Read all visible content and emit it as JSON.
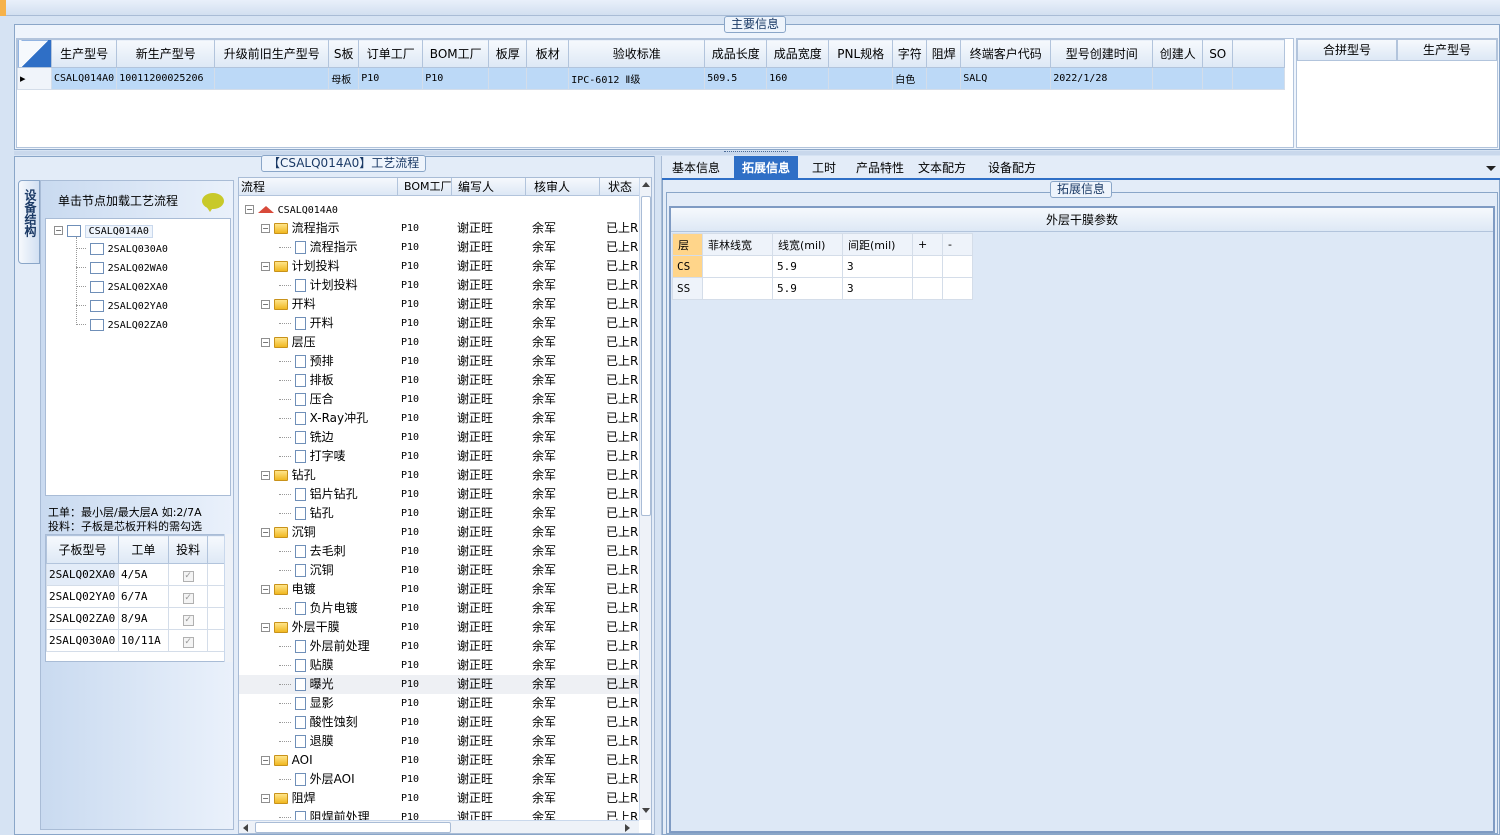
{
  "main_info": {
    "title": "主要信息",
    "headers": [
      "生产型号",
      "新生产型号",
      "升级前旧生产型号",
      "S板",
      "订单工厂",
      "BOM工厂",
      "板厚",
      "板材",
      "验收标准",
      "成品长度",
      "成品宽度",
      "PNL规格",
      "字符",
      "阻焊",
      "终端客户代码",
      "型号创建时间",
      "创建人",
      "SO"
    ],
    "row": [
      "CSALQ014A0",
      "10011200025206",
      "",
      "母板",
      "P10",
      "P10",
      "",
      "",
      "IPC-6012 Ⅱ级",
      "509.5",
      "160",
      "",
      "白色",
      "",
      "SALQ",
      "2022/1/28",
      "",
      ""
    ],
    "right_headers": [
      "合拼型号",
      "生产型号"
    ]
  },
  "flow_panel": {
    "title": "【CSALQ014A0】工艺流程",
    "side_tab": "设备结构",
    "load_hint": "单击节点加载工艺流程",
    "tree": {
      "root": "CSALQ014A0",
      "children": [
        "2SALQ030A0",
        "2SALQ02WA0",
        "2SALQ02XA0",
        "2SALQ02YA0",
        "2SALQ02ZA0"
      ]
    },
    "note_line1": "工单：最小层/最大层A 如:2/7A",
    "note_line2": "投料：子板是芯板开料的需勾选",
    "sub_table": {
      "headers": [
        "子板型号",
        "工单",
        "投料"
      ],
      "rows": [
        {
          "model": "2SALQ02XA0",
          "order": "4/5A"
        },
        {
          "model": "2SALQ02YA0",
          "order": "6/7A"
        },
        {
          "model": "2SALQ02ZA0",
          "order": "8/9A"
        },
        {
          "model": "2SALQ030A0",
          "order": "10/11A"
        }
      ]
    },
    "columns": [
      "流程",
      "BOM工厂",
      "编写人",
      "核审人",
      "状态"
    ],
    "root_name": "CSALQ014A0",
    "factory": "P10",
    "writer": "谢正旺",
    "reviewer": "余军",
    "status": "已上RI",
    "rows": [
      {
        "name": "流程指示",
        "level": 1
      },
      {
        "name": "流程指示",
        "level": 2
      },
      {
        "name": "计划投料",
        "level": 1
      },
      {
        "name": "计划投料",
        "level": 2
      },
      {
        "name": "开料",
        "level": 1
      },
      {
        "name": "开料",
        "level": 2
      },
      {
        "name": "层压",
        "level": 1
      },
      {
        "name": "预排",
        "level": 2
      },
      {
        "name": "排板",
        "level": 2
      },
      {
        "name": "压合",
        "level": 2
      },
      {
        "name": "X-Ray冲孔",
        "level": 2
      },
      {
        "name": "铣边",
        "level": 2
      },
      {
        "name": "打字唛",
        "level": 2
      },
      {
        "name": "钻孔",
        "level": 1
      },
      {
        "name": "铝片钻孔",
        "level": 2
      },
      {
        "name": "钻孔",
        "level": 2
      },
      {
        "name": "沉铜",
        "level": 1
      },
      {
        "name": "去毛刺",
        "level": 2
      },
      {
        "name": "沉铜",
        "level": 2
      },
      {
        "name": "电镀",
        "level": 1
      },
      {
        "name": "负片电镀",
        "level": 2
      },
      {
        "name": "外层干膜",
        "level": 1
      },
      {
        "name": "外层前处理",
        "level": 2
      },
      {
        "name": "贴膜",
        "level": 2
      },
      {
        "name": "曝光",
        "level": 2
      },
      {
        "name": "显影",
        "level": 2
      },
      {
        "name": "酸性蚀刻",
        "level": 2
      },
      {
        "name": "退膜",
        "level": 2
      },
      {
        "name": "AOI",
        "level": 1
      },
      {
        "name": "外层AOI",
        "level": 2
      },
      {
        "name": "阻焊",
        "level": 1
      },
      {
        "name": "阻焊前处理",
        "level": 2
      }
    ]
  },
  "detail_panel": {
    "tabs": [
      "基本信息",
      "拓展信息",
      "工时",
      "产品特性",
      "文本配方",
      "设备配方"
    ],
    "active_tab": "拓展信息",
    "group_title": "拓展信息",
    "param_title": "外层干膜参数",
    "param_headers": [
      "层",
      "菲林线宽",
      "线宽(mil)",
      "间距(mil)",
      "+",
      "-"
    ],
    "param_rows": [
      {
        "layer": "CS",
        "film": "",
        "width": "5.9",
        "spacing": "3"
      },
      {
        "layer": "SS",
        "film": "",
        "width": "5.9",
        "spacing": "3"
      }
    ]
  },
  "colors": {
    "accent": "#2f6fc6",
    "selected_row": "#bcd9f7",
    "orange": "#ffd58a"
  }
}
